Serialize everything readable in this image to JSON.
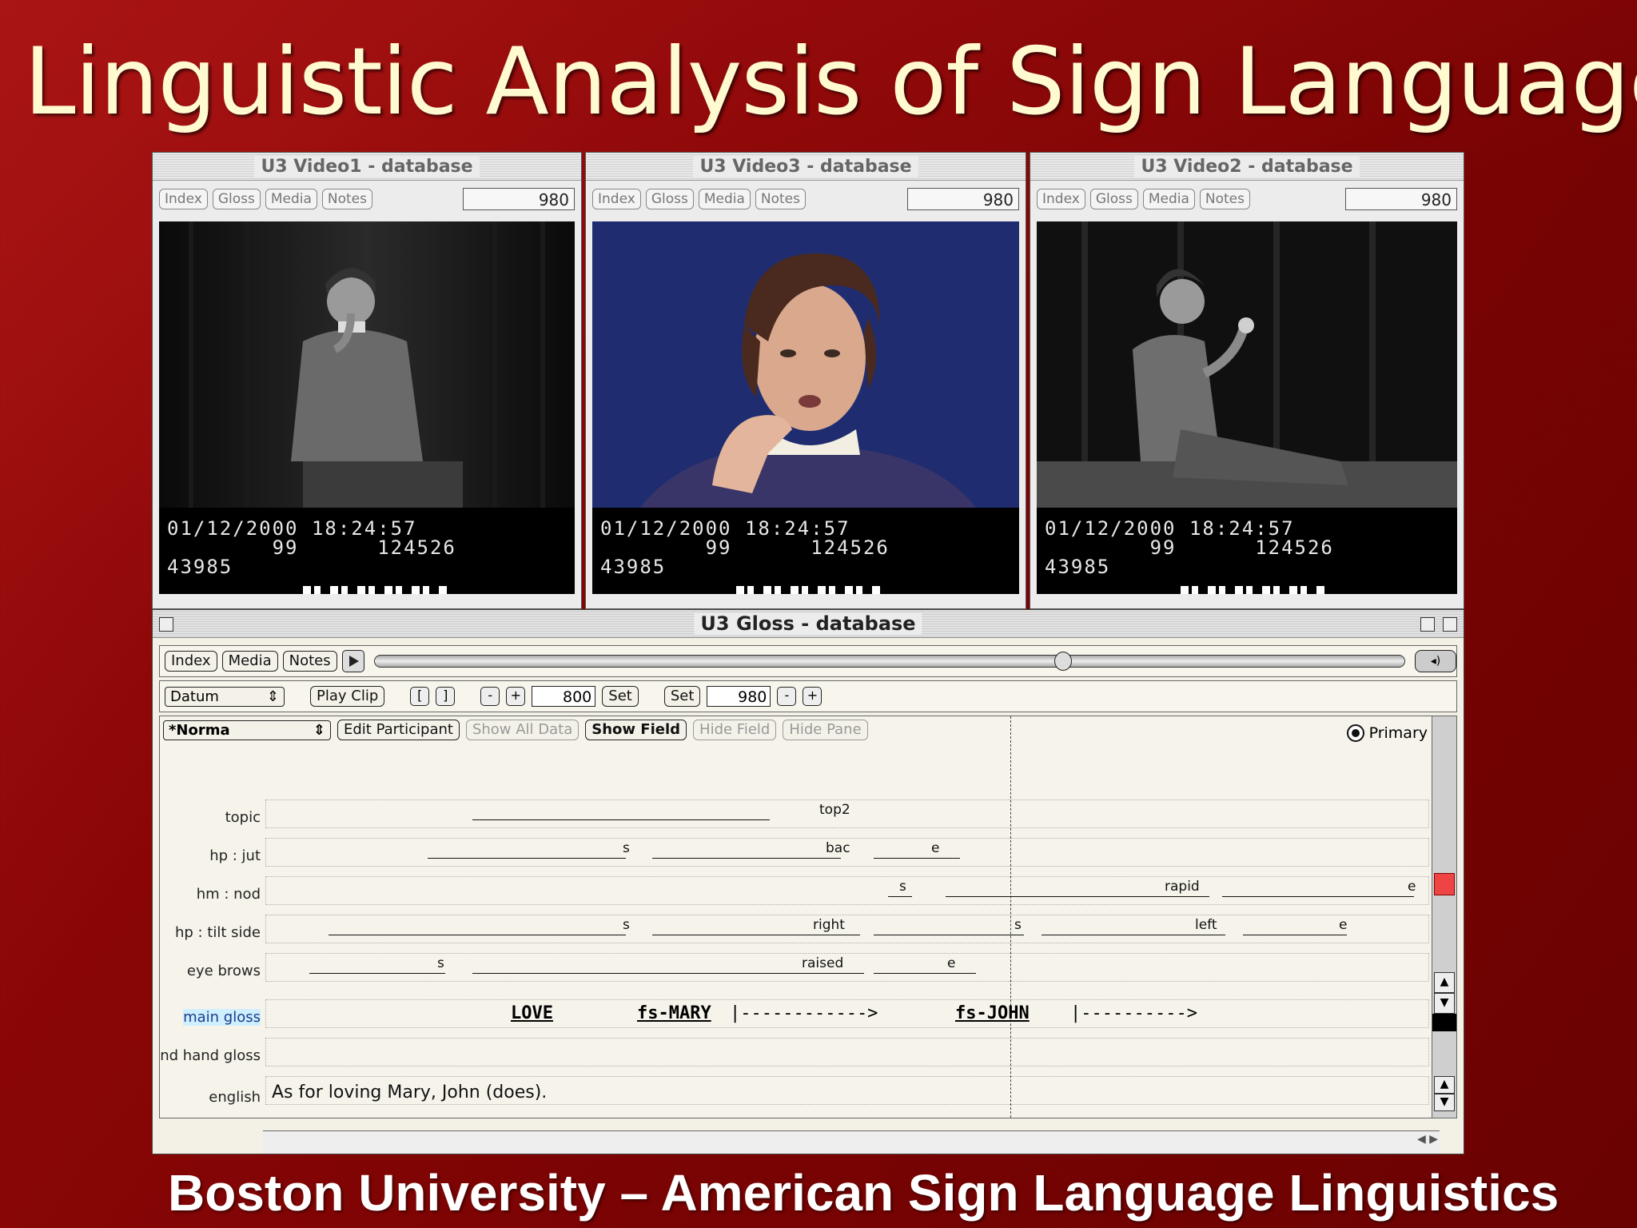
{
  "slide": {
    "title": "Linguistic Analysis of Sign Language",
    "footer": "Boston University – American Sign Language Linguistics"
  },
  "video_windows": [
    {
      "title": "U3 Video1 - database",
      "tabs": [
        "Index",
        "Gloss",
        "Media",
        "Notes"
      ],
      "frame": "980",
      "overlay": {
        "date_time": "01/12/2000 18:24:57",
        "line2": "        99      124526",
        "line3": "43985"
      }
    },
    {
      "title": "U3 Video3 - database",
      "tabs": [
        "Index",
        "Gloss",
        "Media",
        "Notes"
      ],
      "frame": "980",
      "overlay": {
        "date_time": "01/12/2000 18:24:57",
        "line2": "        99      124526",
        "line3": "43985"
      }
    },
    {
      "title": "U3 Video2 - database",
      "tabs": [
        "Index",
        "Gloss",
        "Media",
        "Notes"
      ],
      "frame": "980",
      "overlay": {
        "date_time": "01/12/2000 18:24:57",
        "line2": "        99      124526",
        "line3": "43985"
      }
    }
  ],
  "gloss_window": {
    "title": "U3 Gloss - database",
    "row1": {
      "index": "Index",
      "media": "Media",
      "notes": "Notes",
      "scrub_position": 0.66
    },
    "row2": {
      "datum": "Datum",
      "play_clip": "Play Clip",
      "start_value": "800",
      "set1": "Set",
      "set2": "Set",
      "end_value": "980",
      "minus": "-",
      "plus": "+"
    },
    "row3": {
      "participant": "*Norma",
      "edit_participant": "Edit Participant",
      "show_all_data": "Show All Data",
      "show_field": "Show Field",
      "hide_field": "Hide Field",
      "hide_pane": "Hide Pane",
      "primary": "Primary"
    },
    "tiers": {
      "topic": {
        "label": "topic",
        "values": [
          "top2"
        ]
      },
      "hp_jut": {
        "label": "hp : jut",
        "values": [
          "s",
          "bac",
          "e"
        ]
      },
      "hm_nod": {
        "label": "hm : nod",
        "values": [
          "s",
          "rapid",
          "e"
        ]
      },
      "hp_tilt_side": {
        "label": "hp : tilt side",
        "values": [
          "s",
          "right",
          "s",
          "left",
          "e"
        ]
      },
      "eye_brows": {
        "label": "eye brows",
        "values": [
          "s",
          "raised",
          "e"
        ]
      },
      "main_gloss": {
        "label": "main gloss",
        "values": [
          "LOVE",
          "fs-MARY",
          "|------------>",
          "fs-JOHN",
          "|---------->"
        ]
      },
      "nd_hand_gloss": {
        "label": "nd hand gloss",
        "values": []
      },
      "english": {
        "label": "english",
        "value": "As for loving Mary, John (does)."
      }
    }
  }
}
